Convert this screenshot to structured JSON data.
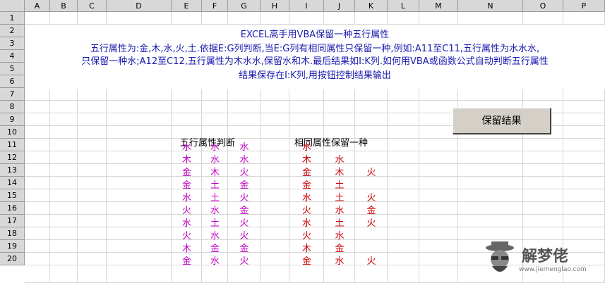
{
  "columns": [
    "A",
    "B",
    "C",
    "D",
    "E",
    "F",
    "G",
    "H",
    "I",
    "J",
    "K",
    "L",
    "M",
    "N",
    "O",
    "P"
  ],
  "rows": [
    "1",
    "2",
    "3",
    "4",
    "5",
    "6",
    "7",
    "8",
    "9",
    "10",
    "11",
    "12",
    "13",
    "14",
    "15",
    "16",
    "17",
    "18",
    "19",
    "20"
  ],
  "description": {
    "line1": "EXCEL高手用VBA保留一种五行属性",
    "line2": "五行属性为:金,木,水,火,土.依据E:G列判断,当E:G列有相同属性只保留一种,例如:A11至C11,五行属性为水水水,",
    "line3": "只保留一种水;A12至C12,五行属性为木水水,保留水和木.最后结果如I:K列.如何用VBA或函数公式自动判断五行属性",
    "line4": "结果保存在I:K列,用按钮控制结果输出"
  },
  "headers": {
    "source": "五行属性判断",
    "result": "相同属性保留一种"
  },
  "button": {
    "label": "保留结果"
  },
  "source_rows": [
    [
      "水",
      "水",
      "水"
    ],
    [
      "木",
      "水",
      "水"
    ],
    [
      "金",
      "木",
      "火"
    ],
    [
      "金",
      "土",
      "金"
    ],
    [
      "水",
      "土",
      "火"
    ],
    [
      "火",
      "水",
      "金"
    ],
    [
      "水",
      "土",
      "火"
    ],
    [
      "火",
      "水",
      "火"
    ],
    [
      "木",
      "金",
      "金"
    ],
    [
      "金",
      "水",
      "火"
    ]
  ],
  "result_rows": [
    [
      "水",
      "",
      ""
    ],
    [
      "木",
      "水",
      ""
    ],
    [
      "金",
      "木",
      "火"
    ],
    [
      "金",
      "土",
      ""
    ],
    [
      "水",
      "土",
      "火"
    ],
    [
      "火",
      "水",
      "金"
    ],
    [
      "水",
      "土",
      "火"
    ],
    [
      "火",
      "水",
      ""
    ],
    [
      "木",
      "金",
      ""
    ],
    [
      "金",
      "水",
      "火"
    ]
  ],
  "watermark": {
    "text": "解梦佬",
    "url": "www.jiemenglao.com"
  },
  "colors": {
    "source_text": "#c000c0",
    "result_text": "#d00000",
    "title_text": "#1a1ab0"
  }
}
